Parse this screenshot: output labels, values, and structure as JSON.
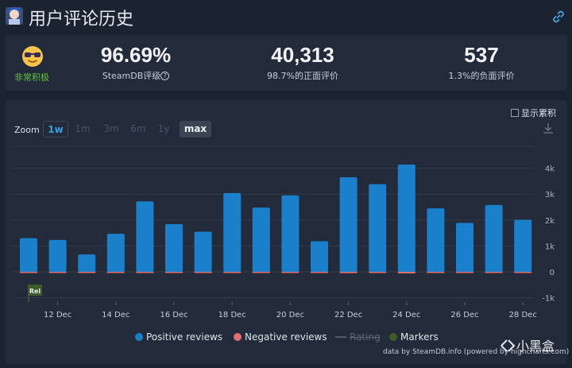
{
  "header": {
    "title": "用户评论历史"
  },
  "summary": {
    "rating_word": "非常积极",
    "score": "96.69%",
    "score_label": "SteamDB评级",
    "positive_count": "40,313",
    "positive_label": "98.7%的正面评价",
    "negative_count": "537",
    "negative_label": "1.3%的负面评价"
  },
  "controls": {
    "show_cumulative": "显示累积",
    "zoom_label": "Zoom",
    "zoom_options": [
      "1w",
      "1m",
      "3m",
      "6m",
      "1y",
      "max"
    ],
    "active_zoom": "1w",
    "selected_zoom": "max"
  },
  "legend": {
    "positive": "Positive reviews",
    "negative": "Negative reviews",
    "rating": "Rating",
    "markers": "Markers"
  },
  "credit": "data by SteamDB.info (powered by highcharts.com)",
  "watermark": "小黑盒",
  "chart_data": {
    "type": "bar",
    "x": [
      "11 Dec",
      "12 Dec",
      "13 Dec",
      "14 Dec",
      "15 Dec",
      "16 Dec",
      "17 Dec",
      "18 Dec",
      "19 Dec",
      "20 Dec",
      "21 Dec",
      "22 Dec",
      "23 Dec",
      "24 Dec",
      "25 Dec",
      "26 Dec",
      "27 Dec",
      "28 Dec"
    ],
    "x_tick_labels": [
      "12 Dec",
      "14 Dec",
      "16 Dec",
      "18 Dec",
      "20 Dec",
      "22 Dec",
      "24 Dec",
      "26 Dec",
      "28 Dec"
    ],
    "series": [
      {
        "name": "Positive reviews",
        "color": "#1a80cc",
        "values": [
          1300,
          1230,
          670,
          1470,
          2720,
          1840,
          1550,
          3040,
          2480,
          2950,
          1180,
          3650,
          3380,
          4140,
          2450,
          1890,
          2580,
          2010
        ]
      },
      {
        "name": "Negative reviews",
        "color": "#e07070",
        "values": [
          15,
          12,
          8,
          20,
          35,
          25,
          20,
          40,
          30,
          38,
          15,
          50,
          45,
          60,
          30,
          25,
          35,
          28
        ]
      }
    ],
    "y_ticks": [
      "-1k",
      "0",
      "1k",
      "2k",
      "3k",
      "4k"
    ],
    "ylim": [
      -1000,
      4500
    ],
    "marker": {
      "label": "Rel",
      "color": "#3d5c2a"
    },
    "grid": true,
    "legend_position": "bottom"
  }
}
